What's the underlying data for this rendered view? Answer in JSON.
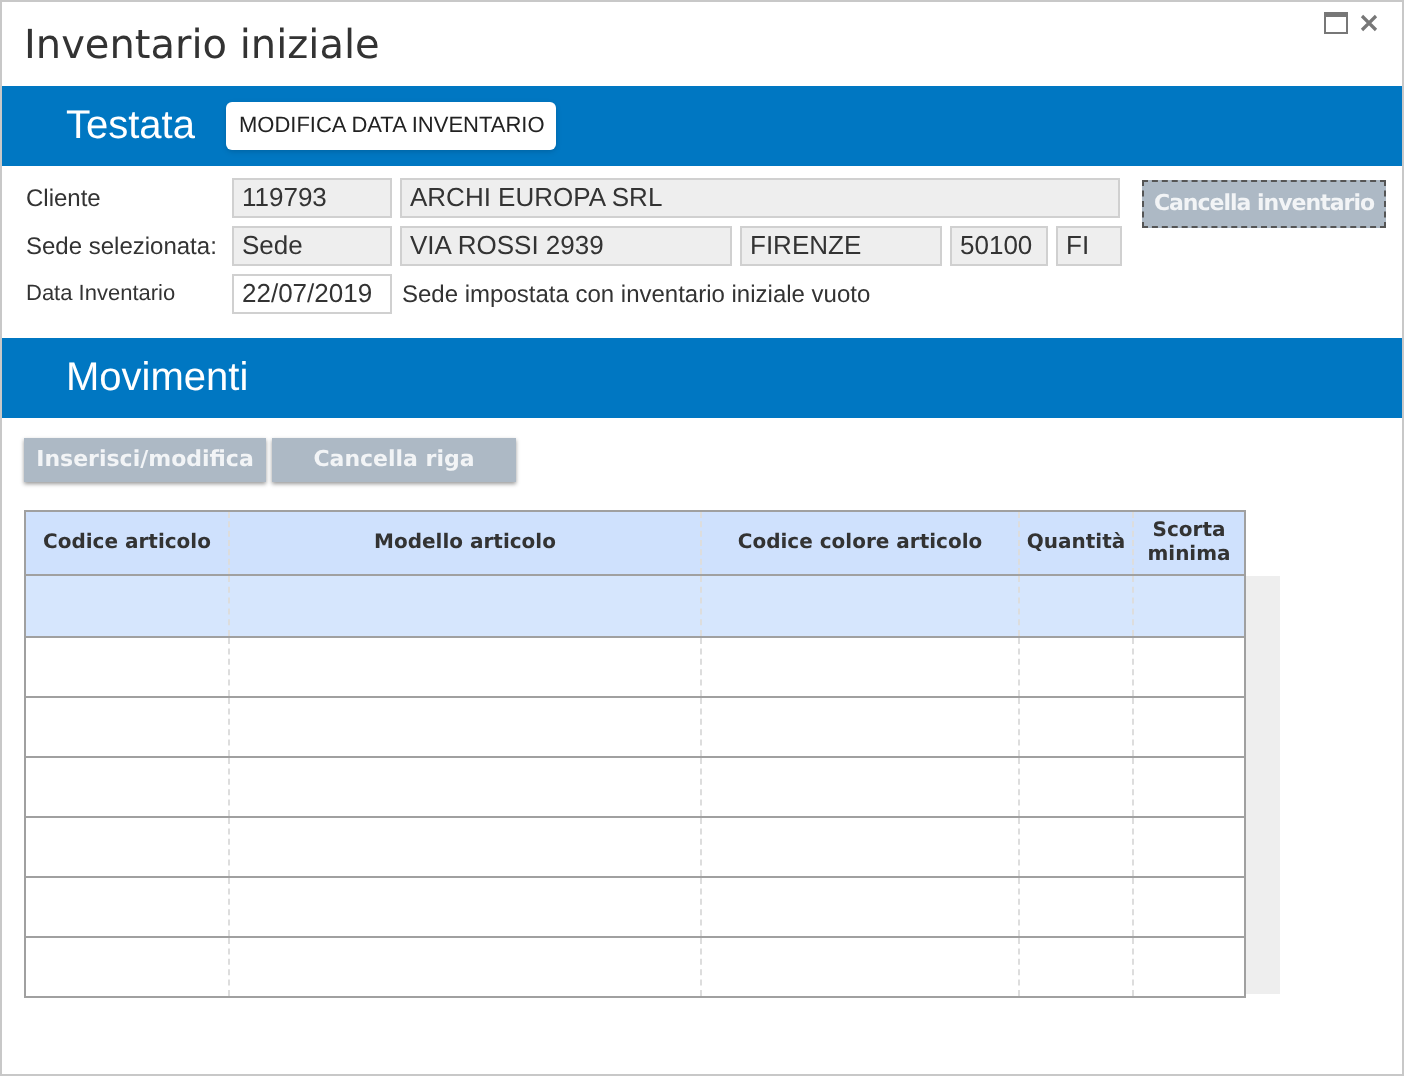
{
  "window": {
    "title": "Inventario iniziale"
  },
  "testata": {
    "title": "Testata",
    "edit_button": "MODIFICA DATA INVENTARIO",
    "cliente": {
      "label": "Cliente",
      "code": "119793",
      "name": "ARCHI EUROPA SRL"
    },
    "sede": {
      "label": "Sede selezionata:",
      "fields": [
        "Sede",
        "VIA ROSSI 2939",
        "FIRENZE",
        "50100",
        "FI"
      ]
    },
    "data": {
      "label": "Data Inventario",
      "value": "22/07/2019",
      "note": "Sede impostata con inventario iniziale vuoto"
    },
    "cancel_button": {
      "label": "Cancella inventario",
      "disabled": true
    }
  },
  "movimenti": {
    "title": "Movimenti",
    "buttons": [
      {
        "label": "Inserisci/modifica",
        "disabled": true
      },
      {
        "label": "Cancella riga",
        "disabled": true
      }
    ]
  },
  "table": {
    "columns": [
      "Codice articolo",
      "Modello articolo",
      "Codice colore articolo",
      "Quantità",
      "Scorta minima"
    ],
    "rows": [
      {
        "selected": true
      },
      {
        "selected": false
      },
      {
        "selected": false
      },
      {
        "selected": false
      },
      {
        "selected": false
      },
      {
        "selected": false
      },
      {
        "selected": false
      }
    ]
  }
}
